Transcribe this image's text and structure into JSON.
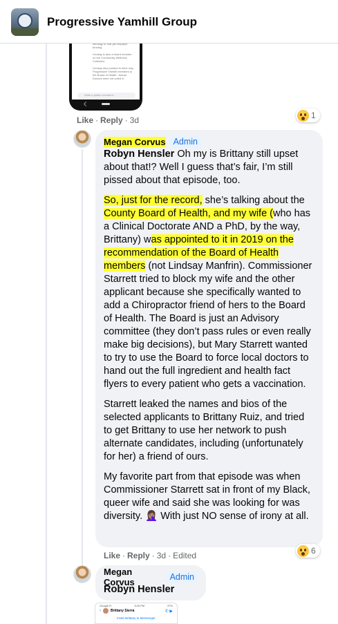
{
  "header": {
    "title": "Progressive Yamhill Group"
  },
  "phone": {
    "lines": [
      "people like Brittany Sierra",
      "ideology or that get taxpayer",
      "funding.",
      "",
      "Lindsay is also a board member",
      "on the Community Wellness",
      "Collective.",
      "",
      "Lindsay also pushed to elect only",
      "Progressive Yamhill members to",
      "the Board of Health . Actual",
      "Doctors were not voted in."
    ],
    "comment_placeholder": "Write a public comment...",
    "send_label": "Send"
  },
  "parent": {
    "like": "Like",
    "reply": "Reply",
    "time": "3d",
    "reactions": "1"
  },
  "comment1": {
    "author": "Megan Corvus",
    "badge": "Admin",
    "mention": "Robyn Hensler",
    "p1_rest": " Oh my is Brittany still upset about that!? Well I guess that’s fair, I’m still pissed about that episode, too.",
    "p2_a": "So, just for the record,",
    "p2_b": " she’s talking about the ",
    "p2_c": "County Board of Health, and my wife (",
    "p2_d": "who has a Clinical Doctorate AND a PhD, by the way, Brittany) w",
    "p2_e": "as appointed to it in 2019 on the recommendation of the Board of Health members",
    "p2_f": " (not Lindsay Manfrin). Commissioner Starrett tried to block my wife and the other applicant because she specifically wanted to add a Chiropractor friend of hers to the Board of Health. The Board is just an Advisory committee (they don’t pass rules or even really make big decisions), but Mary Starrett wanted to try to use the Board to force local doctors to hand out the full ingredient and health fact flyers to every patient who gets a vaccination.",
    "p3": "Starrett leaked the names and bios of the selected applicants to Brittany Ruiz, and tried to get Brittany to use her network to push alternate candidates, including (unfortunately for her) a friend of ours.",
    "p4": "My favorite part from that episode was when Commissioner Starrett sat in front of my Black, queer wife and said she was looking for was diversity. 🤦🏽‍♀️ With just NO sense of irony at all.",
    "like": "Like",
    "reply": "Reply",
    "time": "3d",
    "edited": "Edited",
    "reactions": "6"
  },
  "comment2": {
    "author": "Megan Corvus",
    "badge": "Admin",
    "mention": "Robyn Hensler"
  },
  "messenger": {
    "status_left": "Google Fi",
    "status_time": "3:25 PM",
    "status_right": "37%",
    "name": "Brittany Sierra",
    "invite": "Invite Brittany to Messenger"
  }
}
